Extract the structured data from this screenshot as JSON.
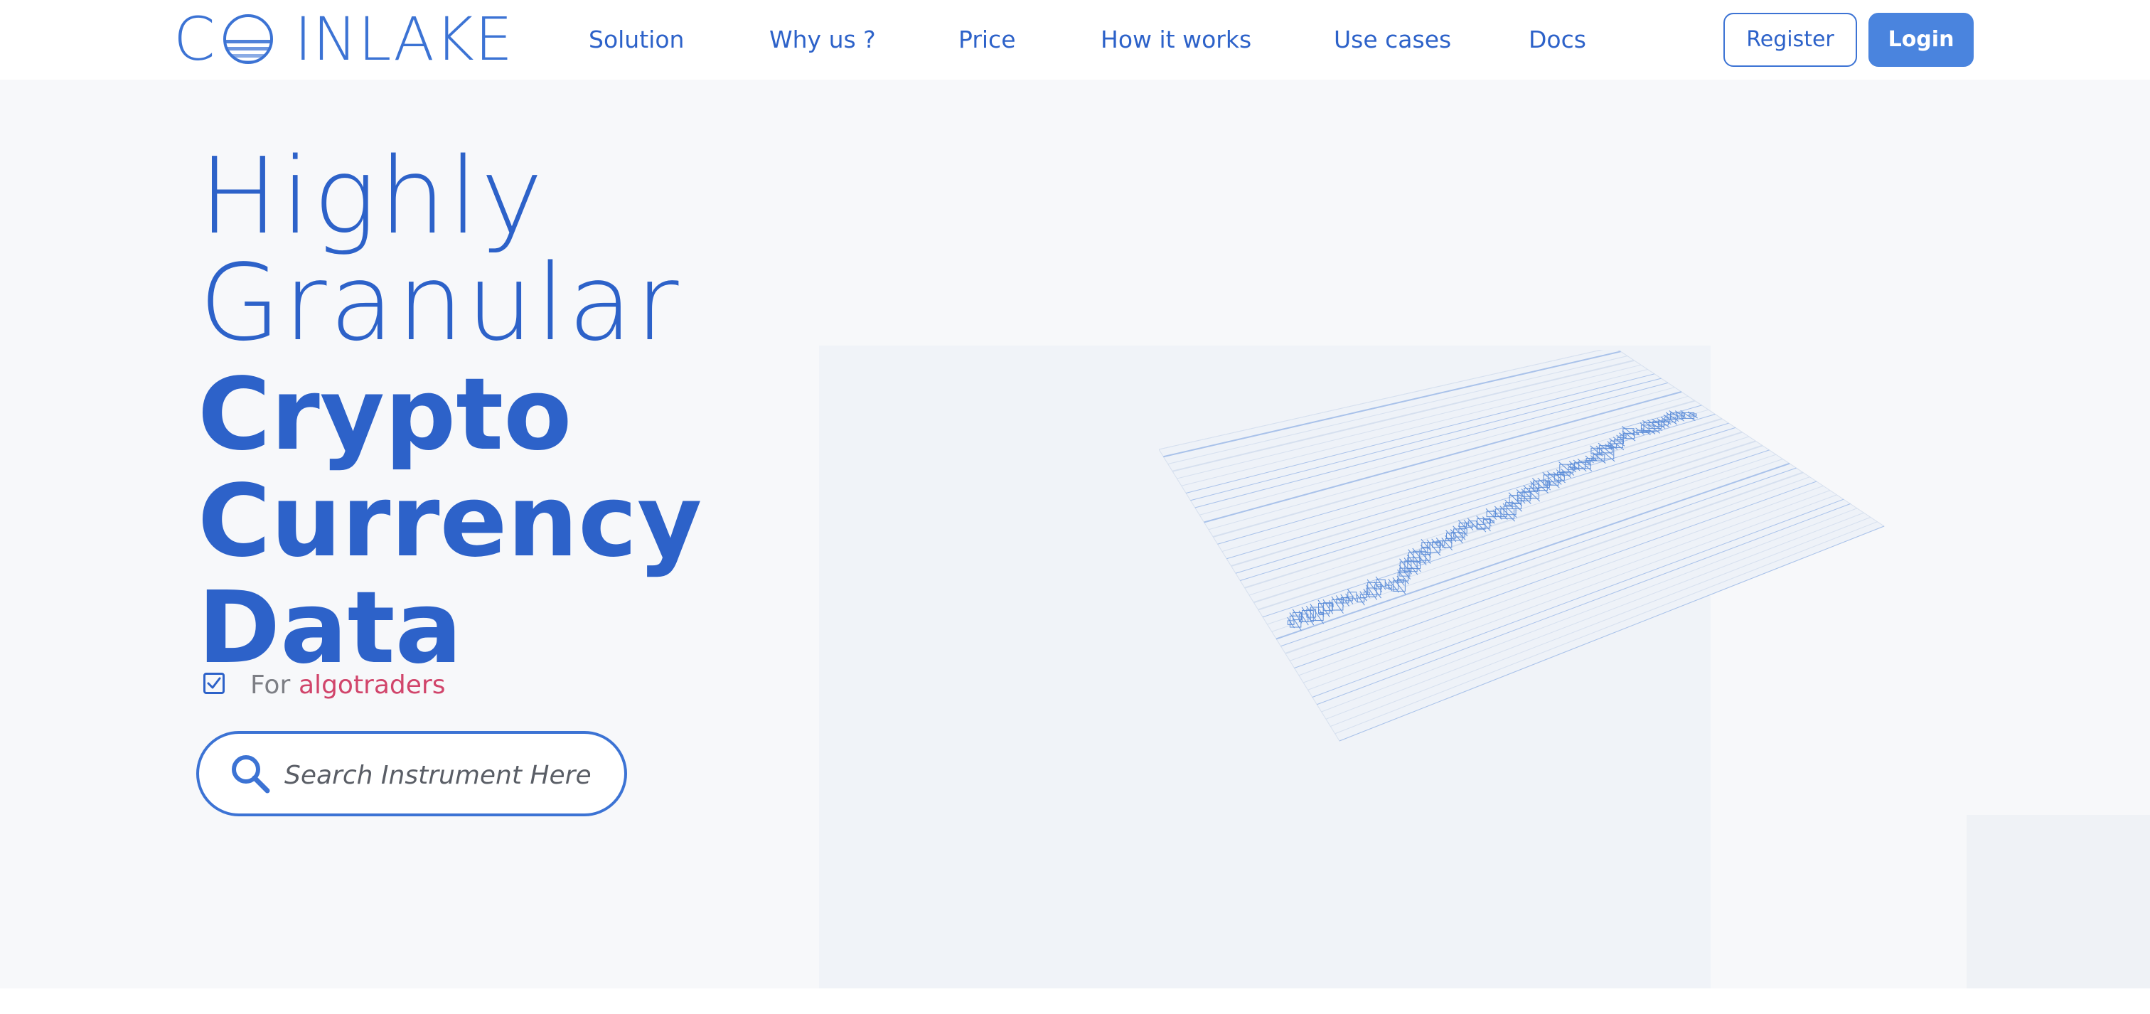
{
  "brand": {
    "logo_first_letter": "C",
    "logo_rest": "INLAKE",
    "primary_color": "#2d62c9",
    "accent_color": "#d1456b",
    "button_color": "#4a84de"
  },
  "nav": {
    "items": [
      {
        "label": "Solution"
      },
      {
        "label": "Why us ?"
      },
      {
        "label": "Price"
      },
      {
        "label": "How it works"
      },
      {
        "label": "Use cases"
      },
      {
        "label": "Docs"
      }
    ]
  },
  "auth": {
    "register_label": "Register",
    "login_label": "Login"
  },
  "hero": {
    "line1": "Highly",
    "line2": "Granular",
    "line3": "Crypto",
    "line4": "Currency",
    "line5": "Data",
    "tagline_prefix": "For",
    "tagline_accent": "algotraders",
    "checkbox_checked": true,
    "icons": [
      "check-icon",
      "search-icon",
      "candlestick-chart-illustration"
    ]
  },
  "search": {
    "placeholder": "Search Instrument Here",
    "value": ""
  }
}
